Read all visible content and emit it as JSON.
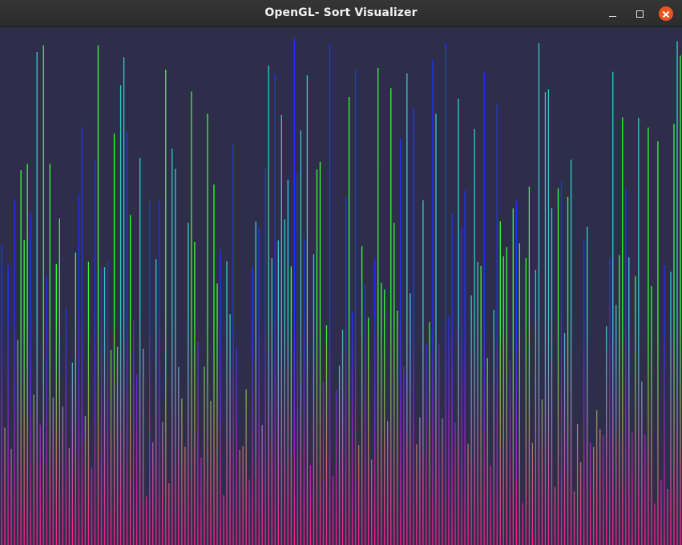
{
  "window": {
    "title": "OpenGL- Sort Visualizer",
    "controls": {
      "minimize_icon": "minimize-icon",
      "maximize_icon": "maximize-icon",
      "close_icon": "close-icon"
    }
  },
  "colors": {
    "titlebar": "#2c2c2c",
    "canvas_background": "#2e2e4a",
    "close_button": "#e95420",
    "bar_bottom": "#ff1a8c",
    "bar_top_colors": [
      "#33ff33",
      "#1a33ff",
      "#33cccc"
    ]
  },
  "visualization": {
    "bar_count": 212,
    "seed": 7,
    "value_min": 0.08,
    "value_max": 1.0
  }
}
